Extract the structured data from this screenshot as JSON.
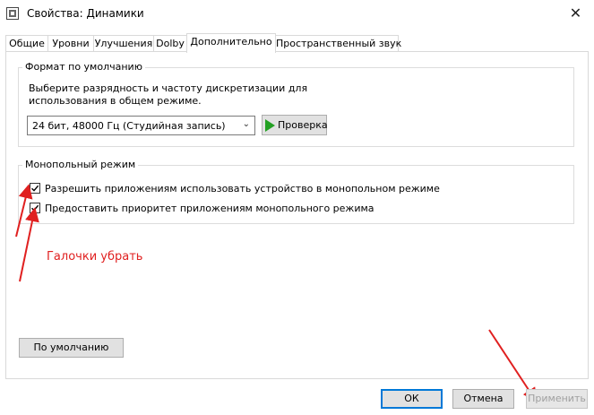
{
  "window": {
    "title": "Свойства: Динамики",
    "close_glyph": "✕"
  },
  "tabs": [
    {
      "label": "Общие",
      "active": false
    },
    {
      "label": "Уровни",
      "active": false
    },
    {
      "label": "Улучшения",
      "active": false
    },
    {
      "label": "Dolby",
      "active": false
    },
    {
      "label": "Дополнительно",
      "active": true
    },
    {
      "label": "Пространственный звук",
      "active": false
    }
  ],
  "default_format": {
    "legend": "Формат по умолчанию",
    "description_line1": "Выберите разрядность и частоту дискретизации для",
    "description_line2": "использования в общем режиме.",
    "selected_value": "24 бит, 48000 Гц (Студийная запись)",
    "test_button": "Проверка"
  },
  "exclusive_mode": {
    "legend": "Монопольный режим",
    "options": [
      {
        "label": "Разрешить приложениям использовать устройство в монопольном режиме",
        "checked": true
      },
      {
        "label": "Предоставить приоритет приложениям монопольного режима",
        "checked": true
      }
    ]
  },
  "annotation": {
    "text": "Галочки убрать",
    "color": "#e02020"
  },
  "buttons": {
    "restore_defaults": "По умолчанию",
    "ok": "ОК",
    "cancel": "Отмена",
    "apply": "Применить"
  },
  "icons": {
    "app": "speaker-properties-icon",
    "close": "close-icon",
    "dropdown": "chevron-down-icon",
    "play": "play-icon",
    "check": "checkmark-icon",
    "arrow": "red-arrow-icon"
  }
}
